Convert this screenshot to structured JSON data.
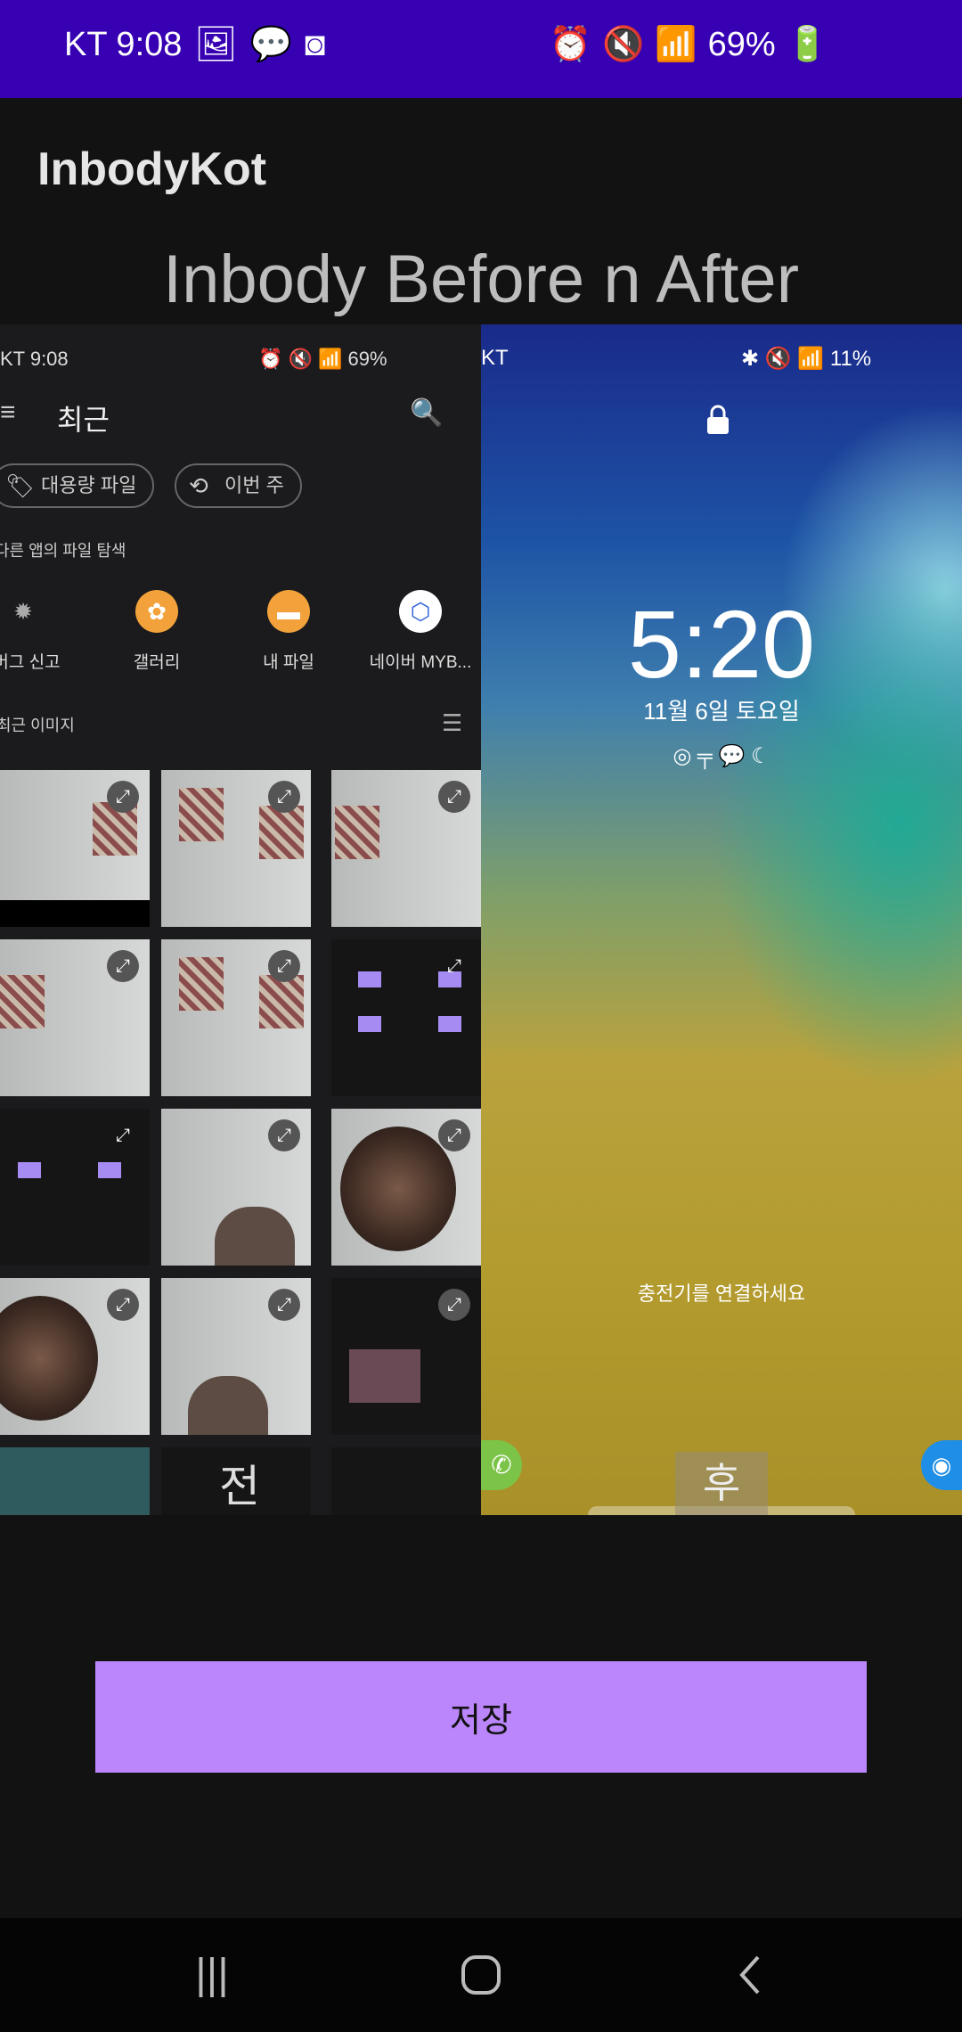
{
  "status_bar": {
    "carrier_time": "KT 9:08",
    "battery": "69%",
    "color": "#3700b3"
  },
  "app": {
    "title": "InbodyKot",
    "heading": "Inbody Before n After"
  },
  "before_panel": {
    "status_time": "KT 9:08",
    "status_battery": "69%",
    "title": "최근",
    "chips": [
      "대용량 파일",
      "이번 주"
    ],
    "section_browse": "다른 앱의 파일 탐색",
    "apps": [
      {
        "label": "버그 신고",
        "icon": "bug-icon"
      },
      {
        "label": "갤러리",
        "icon": "gallery-icon"
      },
      {
        "label": "내 파일",
        "icon": "folder-icon"
      },
      {
        "label": "네이버 MYB...",
        "icon": "naver-icon"
      }
    ],
    "section_recent": "최근 이미지",
    "label": "전"
  },
  "after_panel": {
    "status_carrier": "KT",
    "status_battery": "11%",
    "time": "5:20",
    "date": "11월 6일 토요일",
    "charge_message": "충전기를 연결하세요",
    "label": "후"
  },
  "save_button": {
    "label": "저장",
    "color": "#bb86fc"
  },
  "nav": {
    "recents_icon": "recents-icon",
    "home_icon": "home-icon",
    "back_icon": "back-icon"
  }
}
